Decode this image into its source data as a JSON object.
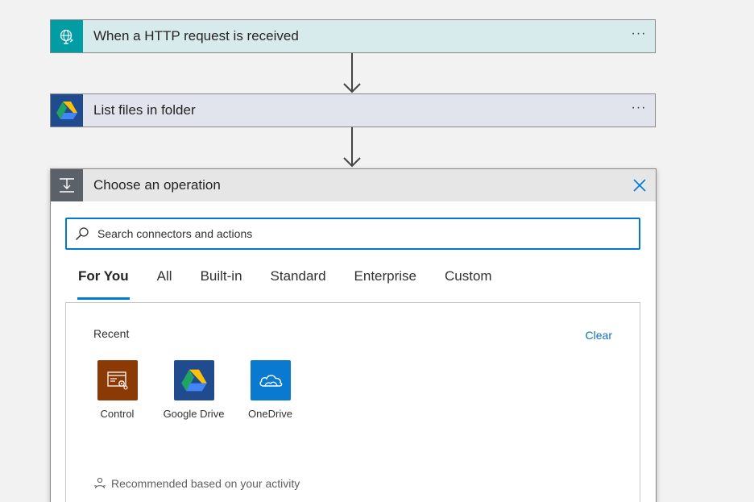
{
  "steps": [
    {
      "title": "When a HTTP request is received",
      "menu": "···",
      "icon": "http-request-icon"
    },
    {
      "title": "List files in folder",
      "menu": "···",
      "icon": "google-drive-icon"
    }
  ],
  "operation_panel": {
    "title": "Choose an operation",
    "search": {
      "placeholder": "Search connectors and actions",
      "value": ""
    },
    "tabs": [
      {
        "label": "For You",
        "active": true
      },
      {
        "label": "All",
        "active": false
      },
      {
        "label": "Built-in",
        "active": false
      },
      {
        "label": "Standard",
        "active": false
      },
      {
        "label": "Enterprise",
        "active": false
      },
      {
        "label": "Custom",
        "active": false
      }
    ],
    "recent": {
      "label": "Recent",
      "clear_label": "Clear",
      "connectors": [
        {
          "label": "Control",
          "color": "#8c3a05",
          "icon": "control-icon"
        },
        {
          "label": "Google Drive",
          "color": "#214b8f",
          "icon": "google-drive-icon"
        },
        {
          "label": "OneDrive",
          "color": "#0a7ad1",
          "icon": "onedrive-icon"
        }
      ]
    },
    "recommended_label": "Recommended based on your activity"
  },
  "colors": {
    "accent": "#0078d4",
    "http_step_bg": "#d8ebec",
    "http_icon_bg": "#009da5",
    "gdrive_step_bg": "#e1e4ec",
    "gdrive_icon_bg": "#214b8f",
    "panel_header_bg": "#e6e6e6",
    "panel_icon_bg": "#5a6169"
  }
}
